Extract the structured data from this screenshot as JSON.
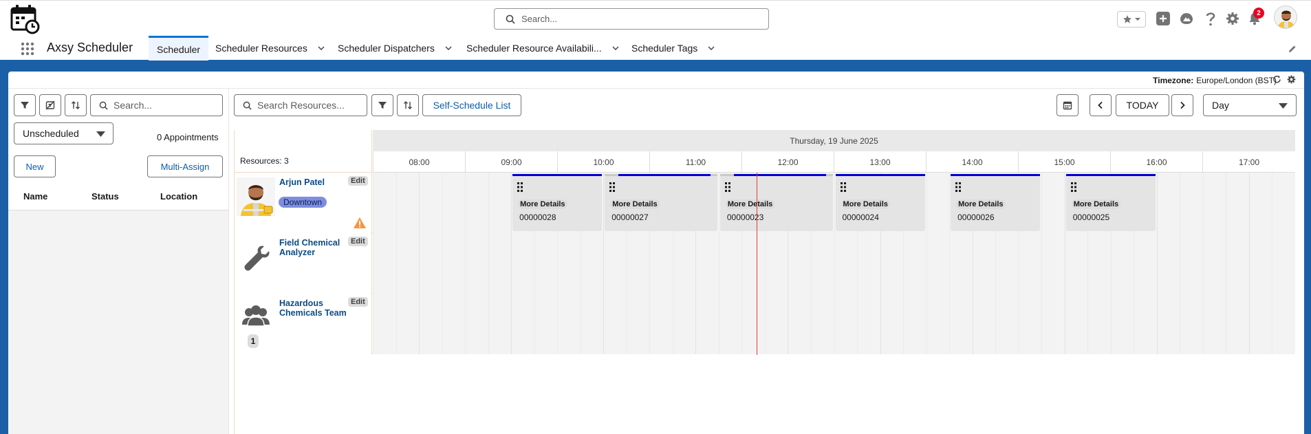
{
  "global": {
    "search_placeholder": "Search...",
    "notification_count": "2"
  },
  "nav": {
    "app_name": "Axsy Scheduler",
    "tabs": [
      {
        "label": "Scheduler"
      },
      {
        "label": "Scheduler Resources"
      },
      {
        "label": "Scheduler Dispatchers"
      },
      {
        "label": "Scheduler Resource Availabili..."
      },
      {
        "label": "Scheduler Tags"
      }
    ]
  },
  "header": {
    "timezone_label": "Timezone:",
    "timezone_value": "Europe/London (BST)"
  },
  "left_panel": {
    "search_placeholder": "Search...",
    "filter_value": "Unscheduled",
    "appointment_count": "0 Appointments",
    "new_label": "New",
    "multi_assign_label": "Multi-Assign",
    "columns": [
      "Name",
      "Status",
      "Location"
    ]
  },
  "toolbar": {
    "search_resources_placeholder": "Search Resources...",
    "self_schedule_label": "Self-Schedule List",
    "today_label": "TODAY",
    "view_value": "Day"
  },
  "grid": {
    "date_label": "Thursday, 19 June 2025",
    "resources_count": "Resources: 3",
    "hours": [
      "08:00",
      "09:00",
      "10:00",
      "11:00",
      "12:00",
      "13:00",
      "14:00",
      "15:00",
      "16:00",
      "17:00"
    ],
    "edit_label": "Edit",
    "resources": [
      {
        "name": "Arjun Patel",
        "badge": "Downtown",
        "warning": true
      },
      {
        "name": "Field Chemical Analyzer"
      },
      {
        "name": "Hazardous Chemicals Team",
        "member_count": "1"
      }
    ],
    "appointments": [
      {
        "label": "More Details",
        "number": "00000028",
        "start": "09:00",
        "end": "10:00"
      },
      {
        "label": "More Details",
        "number": "00000027",
        "start": "10:00",
        "end": "11:15"
      },
      {
        "label": "More Details",
        "number": "00000023",
        "start": "11:15",
        "end": "12:30"
      },
      {
        "label": "More Details",
        "number": "00000024",
        "start": "12:30",
        "end": "13:30"
      },
      {
        "label": "More Details",
        "number": "00000026",
        "start": "13:45",
        "end": "14:45"
      },
      {
        "label": "More Details",
        "number": "00000025",
        "start": "15:00",
        "end": "16:00"
      }
    ],
    "current_time": "11:40"
  },
  "colors": {
    "brand_band": "#1b5fa6",
    "appointment_bar": "#0000d5",
    "now_line": "#e53935",
    "region_badge": "#7f8de1"
  }
}
